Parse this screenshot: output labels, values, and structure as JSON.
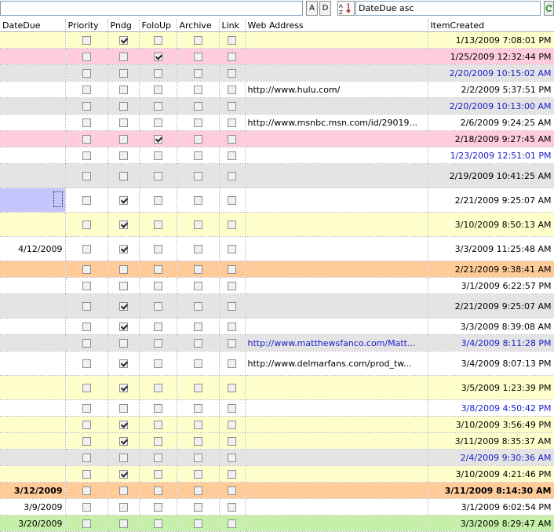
{
  "toolbar": {
    "filter_value": "",
    "asc_label": "A",
    "desc_label": "D",
    "sort_icon": "sort-az-icon",
    "sort_value": "DateDue asc",
    "refresh_icon": "refresh-icon"
  },
  "columns": [
    "DateDue",
    "Priority",
    "Pndg",
    "FoloUp",
    "Archive",
    "Link",
    "Web Address",
    "ItemCreated"
  ],
  "colors": {
    "yellow": "#ffffcc",
    "pink": "#ffccdd",
    "gray": "#e4e4e4",
    "orange": "#ffcc99",
    "green": "#c6f0a9",
    "selection": "#c6c6ff",
    "link_blue": "#1a1acc"
  },
  "rows": [
    {
      "due": "",
      "pri": false,
      "pndg": true,
      "folo": false,
      "arch": false,
      "link": false,
      "web": "",
      "created": "1/13/2009 7:08:01 PM",
      "color": "yellow",
      "text": "normal",
      "h": 21
    },
    {
      "due": "",
      "pri": false,
      "pndg": false,
      "folo": true,
      "arch": false,
      "link": false,
      "web": "",
      "created": "1/25/2009 12:32:44 PM",
      "color": "pink",
      "text": "normal",
      "h": 21
    },
    {
      "due": "",
      "pri": false,
      "pndg": false,
      "folo": false,
      "arch": false,
      "link": false,
      "web": "",
      "created": "2/20/2009 10:15:02 AM",
      "color": "gray",
      "text": "blue",
      "h": 21
    },
    {
      "due": "",
      "pri": false,
      "pndg": false,
      "folo": false,
      "arch": false,
      "link": false,
      "web": "http://www.hulu.com/",
      "created": "2/2/2009 5:37:51 PM",
      "color": "white",
      "text": "normal",
      "h": 21
    },
    {
      "due": "",
      "pri": false,
      "pndg": false,
      "folo": false,
      "arch": false,
      "link": false,
      "web": "",
      "created": "2/20/2009 10:13:00 AM",
      "color": "gray",
      "text": "blue",
      "h": 21
    },
    {
      "due": "",
      "pri": false,
      "pndg": false,
      "folo": false,
      "arch": false,
      "link": false,
      "web": "http://www.msnbc.msn.com/id/29019...",
      "created": "2/6/2009 9:24:25 AM",
      "color": "white",
      "text": "normal",
      "h": 21
    },
    {
      "due": "",
      "pri": false,
      "pndg": false,
      "folo": true,
      "arch": false,
      "link": false,
      "web": "",
      "created": "2/18/2009 9:27:45 AM",
      "color": "pink",
      "text": "normal",
      "h": 21
    },
    {
      "due": "",
      "pri": false,
      "pndg": false,
      "folo": false,
      "arch": false,
      "link": false,
      "web": "",
      "created": "1/23/2009 12:51:01 PM",
      "color": "white",
      "text": "blue",
      "h": 21
    },
    {
      "due": "",
      "pri": false,
      "pndg": false,
      "folo": false,
      "arch": false,
      "link": false,
      "web": "",
      "created": "2/19/2009 10:41:25 AM",
      "color": "gray",
      "text": "normal",
      "h": 31
    },
    {
      "due": "",
      "pri": false,
      "pndg": true,
      "folo": false,
      "arch": false,
      "link": false,
      "web": "",
      "created": "2/21/2009 9:25:07 AM",
      "color": "white",
      "text": "normal",
      "h": 31,
      "selected": true
    },
    {
      "due": "",
      "pri": false,
      "pndg": true,
      "folo": false,
      "arch": false,
      "link": false,
      "web": "",
      "created": "3/10/2009 8:50:13 AM",
      "color": "yellow",
      "text": "normal",
      "h": 31
    },
    {
      "due": "4/12/2009",
      "pri": false,
      "pndg": true,
      "folo": false,
      "arch": false,
      "link": false,
      "web": "",
      "created": "3/3/2009 11:25:48 AM",
      "color": "white",
      "text": "normal",
      "h": 31
    },
    {
      "due": "",
      "pri": false,
      "pndg": false,
      "folo": false,
      "arch": false,
      "link": false,
      "web": "",
      "created": "2/21/2009 9:38:41 AM",
      "color": "orange",
      "text": "normal",
      "h": 21
    },
    {
      "due": "",
      "pri": false,
      "pndg": false,
      "folo": false,
      "arch": false,
      "link": false,
      "web": "",
      "created": "3/1/2009 6:22:57 PM",
      "color": "white",
      "text": "normal",
      "h": 21
    },
    {
      "due": "",
      "pri": false,
      "pndg": true,
      "folo": false,
      "arch": false,
      "link": false,
      "web": "",
      "created": "2/21/2009 9:25:07 AM",
      "color": "gray",
      "text": "normal",
      "h": 31
    },
    {
      "due": "",
      "pri": false,
      "pndg": true,
      "folo": false,
      "arch": false,
      "link": false,
      "web": "",
      "created": "3/3/2009 8:39:08 AM",
      "color": "white",
      "text": "normal",
      "h": 21
    },
    {
      "due": "",
      "pri": false,
      "pndg": false,
      "folo": false,
      "arch": false,
      "link": false,
      "web": "http://www.matthewsfanco.com/Matt...",
      "created": "3/4/2009 8:11:28 PM",
      "color": "gray",
      "text": "blue",
      "h": 21
    },
    {
      "due": "",
      "pri": false,
      "pndg": true,
      "folo": false,
      "arch": false,
      "link": false,
      "web": "http://www.delmarfans.com/prod_tw...",
      "created": "3/4/2009 8:07:13 PM",
      "color": "white",
      "text": "normal",
      "h": 31
    },
    {
      "due": "",
      "pri": false,
      "pndg": true,
      "folo": false,
      "arch": false,
      "link": false,
      "web": "",
      "created": "3/5/2009 1:23:39 PM",
      "color": "yellow",
      "text": "normal",
      "h": 31
    },
    {
      "due": "",
      "pri": false,
      "pndg": false,
      "folo": false,
      "arch": false,
      "link": false,
      "web": "",
      "created": "3/8/2009 4:50:42 PM",
      "color": "white",
      "text": "blue",
      "h": 21
    },
    {
      "due": "",
      "pri": false,
      "pndg": true,
      "folo": false,
      "arch": false,
      "link": false,
      "web": "",
      "created": "3/10/2009 3:56:49 PM",
      "color": "yellow",
      "text": "normal",
      "h": 21
    },
    {
      "due": "",
      "pri": false,
      "pndg": true,
      "folo": false,
      "arch": false,
      "link": false,
      "web": "",
      "created": "3/11/2009 8:35:37 AM",
      "color": "yellow",
      "text": "normal",
      "h": 21
    },
    {
      "due": "",
      "pri": false,
      "pndg": false,
      "folo": false,
      "arch": false,
      "link": false,
      "web": "",
      "created": "2/4/2009 9:30:36 AM",
      "color": "gray",
      "text": "blue",
      "h": 21
    },
    {
      "due": "",
      "pri": false,
      "pndg": true,
      "folo": false,
      "arch": false,
      "link": false,
      "web": "",
      "created": "3/10/2009 4:21:46 PM",
      "color": "yellow",
      "text": "normal",
      "h": 21
    },
    {
      "due": "3/12/2009",
      "pri": false,
      "pndg": false,
      "folo": false,
      "arch": false,
      "link": false,
      "web": "",
      "created": "3/11/2009 8:14:30 AM",
      "color": "orange",
      "text": "bold",
      "h": 21
    },
    {
      "due": "3/9/2009",
      "pri": false,
      "pndg": false,
      "folo": false,
      "arch": false,
      "link": false,
      "web": "",
      "created": "3/1/2009 6:02:54 PM",
      "color": "white",
      "text": "normal",
      "h": 21
    },
    {
      "due": "3/20/2009",
      "pri": false,
      "pndg": false,
      "folo": false,
      "arch": false,
      "link": false,
      "web": "",
      "created": "3/3/2009 8:29:47 AM",
      "color": "green",
      "text": "normal",
      "h": 21
    }
  ]
}
